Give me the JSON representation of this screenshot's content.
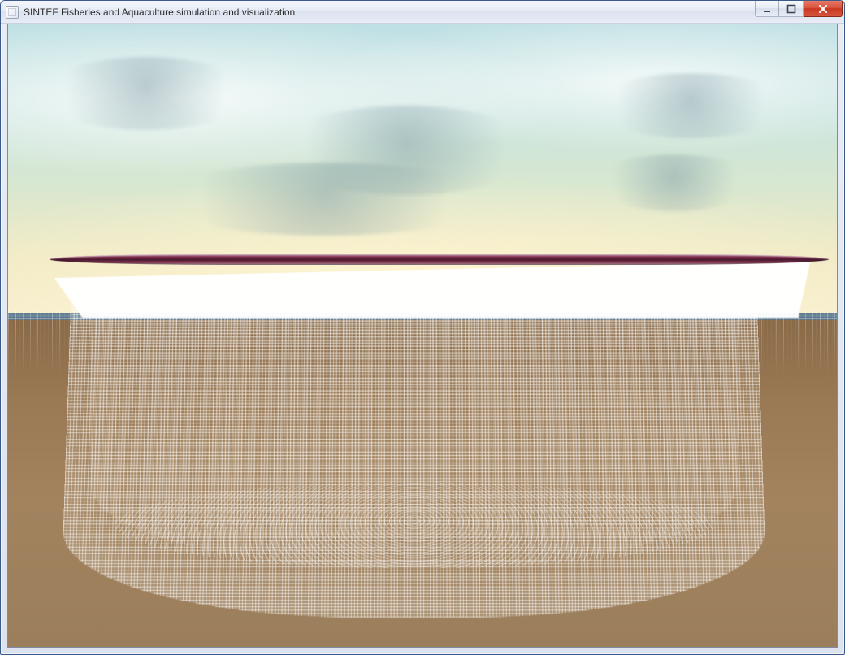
{
  "window": {
    "title": "SINTEF Fisheries and Aquaculture simulation and visualization"
  },
  "icons": {
    "minimize": "minimize-icon",
    "maximize": "maximize-icon",
    "close": "close-icon"
  }
}
